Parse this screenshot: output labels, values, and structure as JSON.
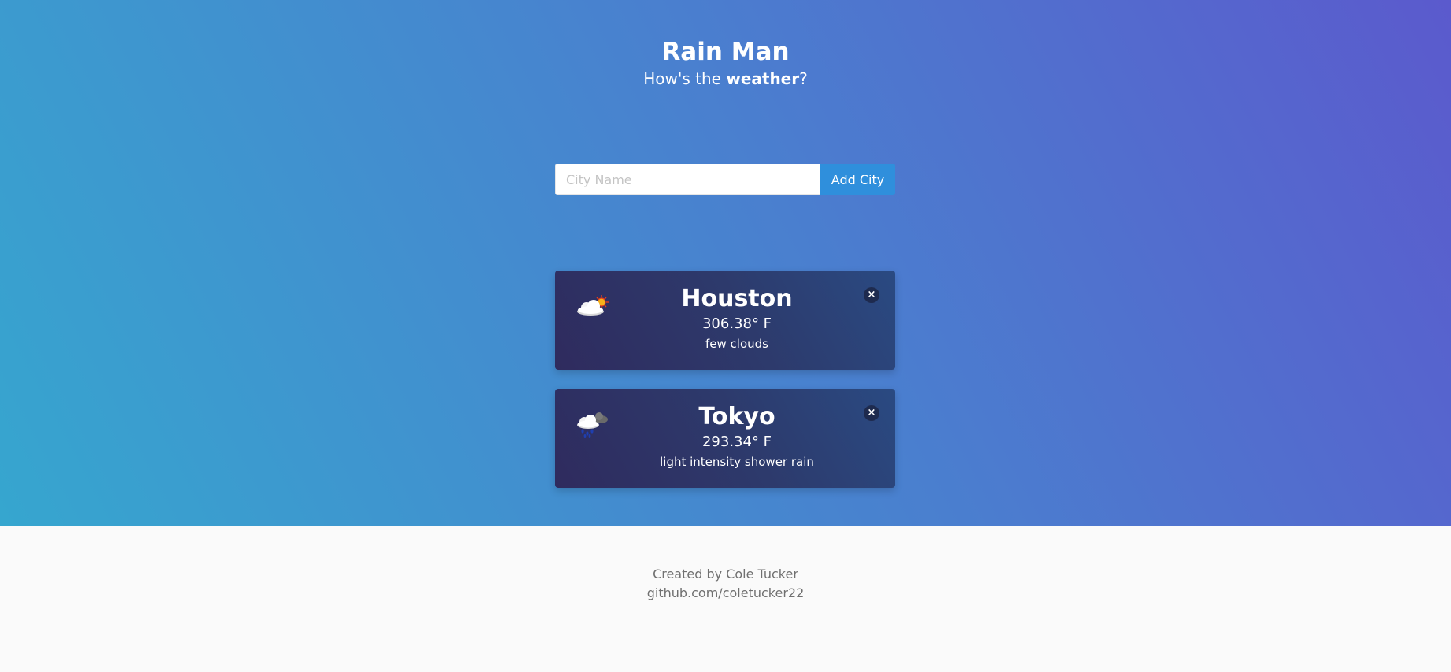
{
  "header": {
    "title": "Rain Man",
    "subtitle_prefix": "How's the ",
    "subtitle_bold": "weather",
    "subtitle_suffix": "?"
  },
  "search": {
    "placeholder": "City Name",
    "value": "",
    "button_label": "Add City",
    "button_color": "#2f8fdc"
  },
  "cities": [
    {
      "name": "Houston",
      "temp": "306.38° F",
      "description": "few clouds",
      "icon": "few-clouds-icon",
      "close_label": "×"
    },
    {
      "name": "Tokyo",
      "temp": "293.34° F",
      "description": "light intensity shower rain",
      "icon": "shower-rain-icon",
      "close_label": "×"
    }
  ],
  "footer": {
    "credit": "Created by Cole Tucker",
    "link": "github.com/coletucker22"
  },
  "colors": {
    "gradient_start": "#36a6cf",
    "gradient_end": "#5b5acd",
    "card_background": "#2d3a6c",
    "footer_background": "#fafafa"
  }
}
